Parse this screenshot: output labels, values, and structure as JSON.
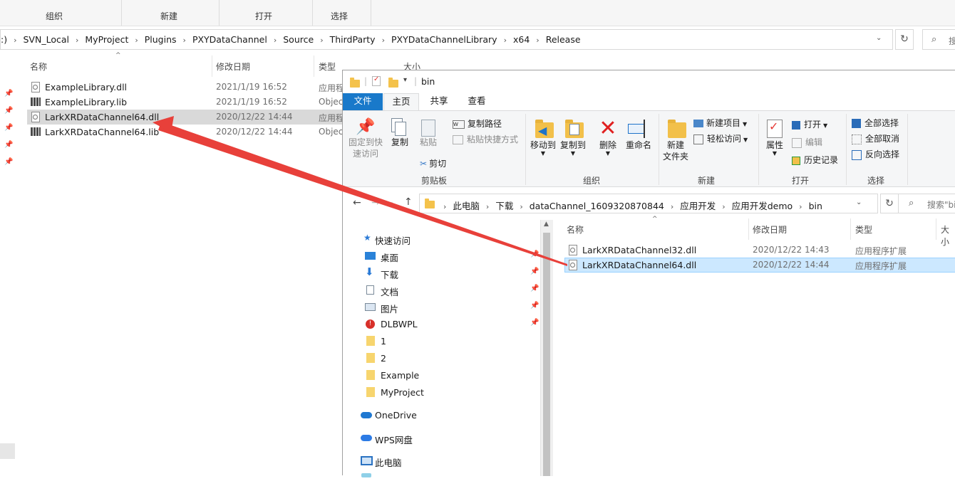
{
  "back_window": {
    "ribbon_groups": [
      "组织",
      "新建",
      "打开",
      "选择"
    ],
    "breadcrumbs": [
      ":)",
      "SVN_Local",
      "MyProject",
      "Plugins",
      "PXYDataChannel",
      "Source",
      "ThirdParty",
      "PXYDataChannelLibrary",
      "x64",
      "Release"
    ],
    "search_placeholder": "搜",
    "columns": [
      "名称",
      "修改日期",
      "类型",
      "大小"
    ],
    "files": [
      {
        "name": "ExampleLibrary.dll",
        "date": "2021/1/19 16:52",
        "type": "应用程",
        "icon": "dll-file-icon"
      },
      {
        "name": "ExampleLibrary.lib",
        "date": "2021/1/19 16:52",
        "type": "Objec",
        "icon": "lib-file-icon"
      },
      {
        "name": "LarkXRDataChannel64.dll",
        "date": "2020/12/22 14:44",
        "type": "应用程",
        "icon": "dll-file-icon",
        "selected": true
      },
      {
        "name": "LarkXRDataChannel64.lib",
        "date": "2020/12/22 14:44",
        "type": "Objec",
        "icon": "lib-file-icon"
      }
    ]
  },
  "front_window": {
    "title": "bin",
    "tabs": [
      "文件",
      "主页",
      "共享",
      "查看"
    ],
    "ribbon": {
      "clipboard": {
        "pin": "固定到快\n速访问",
        "copy": "复制",
        "paste": "粘贴",
        "copy_path": "复制路径",
        "paste_shortcut": "粘贴快捷方式",
        "cut": "剪切",
        "label": "剪贴板"
      },
      "organize": {
        "move_to": "移动到",
        "copy_to": "复制到",
        "delete": "删除",
        "rename": "重命名",
        "label": "组织"
      },
      "new": {
        "new_folder": "新建\n文件夹",
        "new_item": "新建项目",
        "easy_access": "轻松访问",
        "label": "新建"
      },
      "open": {
        "properties": "属性",
        "open": "打开",
        "edit": "编辑",
        "history": "历史记录",
        "label": "打开"
      },
      "select": {
        "select_all": "全部选择",
        "select_none": "全部取消",
        "invert": "反向选择",
        "label": "选择"
      }
    },
    "breadcrumbs": [
      "此电脑",
      "下载",
      "dataChannel_1609320870844",
      "应用开发",
      "应用开发demo",
      "bin"
    ],
    "search_placeholder": "搜索\"bi",
    "nav_items": [
      {
        "label": "快速访问",
        "icon": "star-icon"
      },
      {
        "label": "桌面",
        "icon": "desktop-icon",
        "pinned": true
      },
      {
        "label": "下载",
        "icon": "download-icon",
        "pinned": true
      },
      {
        "label": "文档",
        "icon": "document-icon",
        "pinned": true
      },
      {
        "label": "图片",
        "icon": "picture-icon",
        "pinned": true
      },
      {
        "label": "DLBWPL",
        "icon": "warning-folder-icon",
        "pinned": true
      },
      {
        "label": "1",
        "icon": "folder-icon"
      },
      {
        "label": "2",
        "icon": "folder-icon"
      },
      {
        "label": "Example",
        "icon": "folder-icon"
      },
      {
        "label": "MyProject",
        "icon": "folder-icon"
      },
      {
        "label": "OneDrive",
        "icon": "cloud-icon"
      },
      {
        "label": "WPS网盘",
        "icon": "wps-cloud-icon"
      },
      {
        "label": "此电脑",
        "icon": "computer-icon"
      }
    ],
    "columns": [
      "名称",
      "修改日期",
      "类型",
      "大小"
    ],
    "files": [
      {
        "name": "LarkXRDataChannel32.dll",
        "date": "2020/12/22 14:43",
        "type": "应用程序扩展"
      },
      {
        "name": "LarkXRDataChannel64.dll",
        "date": "2020/12/22 14:44",
        "type": "应用程序扩展",
        "selected": true
      }
    ]
  },
  "colors": {
    "accent": "#1979ca",
    "arrow": "#e8403a",
    "selection": "#cce8ff"
  }
}
